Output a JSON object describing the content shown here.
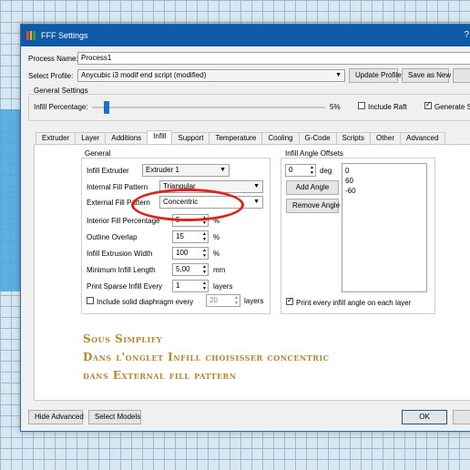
{
  "window": {
    "title": "FFF Settings",
    "help": "?"
  },
  "process": {
    "label": "Process Name:",
    "value": "Process1"
  },
  "profile": {
    "label": "Select Profile:",
    "value": "Anycubic i3 modif end script (modified)",
    "update_button": "Update Profile",
    "save_as_button": "Save as New"
  },
  "general_settings": {
    "title": "General Settings",
    "infill_label": "Infill Percentage:",
    "infill_value": "5%",
    "infill_fraction": 0.05,
    "include_raft_label": "Include Raft",
    "include_raft_checked": false,
    "generate_support_label": "Generate S",
    "generate_support_checked": true
  },
  "tabs": [
    "Extruder",
    "Layer",
    "Additions",
    "Infill",
    "Support",
    "Temperature",
    "Cooling",
    "G-Code",
    "Scripts",
    "Other",
    "Advanced"
  ],
  "active_tab": "Infill",
  "infill_general": {
    "title": "General",
    "infill_extruder_label": "Infill Extruder",
    "infill_extruder_value": "Extruder 1",
    "internal_fill_label": "Internal Fill Pattern",
    "internal_fill_value": "Triangular",
    "external_fill_label": "External Fill Pattern",
    "external_fill_value": "Concentric",
    "interior_fill_label": "Interior Fill Percentage",
    "interior_fill_value": "5",
    "outline_overlap_label": "Outline Overlap",
    "outline_overlap_value": "15",
    "extrusion_width_label": "Infill Extrusion Width",
    "extrusion_width_value": "100",
    "min_infill_length_label": "Minimum Infill Length",
    "min_infill_length_value": "5,00",
    "print_sparse_label": "Print Sparse Infill Every",
    "print_sparse_value": "1",
    "layers_unit": "layers",
    "percent_unit": "%",
    "mm_unit": "mm",
    "solid_diaphragm_label": "Include solid diaphragm every",
    "solid_diaphragm_value": "20",
    "solid_diaphragm_checked": false
  },
  "angle_offsets": {
    "title": "Infill Angle Offsets",
    "angle_value": "0",
    "deg_unit": "deg",
    "add_button": "Add Angle",
    "remove_button": "Remove Angle",
    "list": [
      "0",
      "60",
      "-60"
    ],
    "print_every_label": "Print every infill angle on each layer",
    "print_every_checked": true
  },
  "annotation": {
    "line1": "Sous Simplify",
    "line2": "Dans l'onglet Infill choisisser concentric",
    "line3": "dans External fill pattern",
    "color": "#b8862b"
  },
  "footer": {
    "hide_advanced": "Hide Advanced",
    "select_models": "Select Models",
    "ok": "OK"
  },
  "colors": {
    "titlebar": "#0e5aa7",
    "highlight": "#d9261c"
  }
}
